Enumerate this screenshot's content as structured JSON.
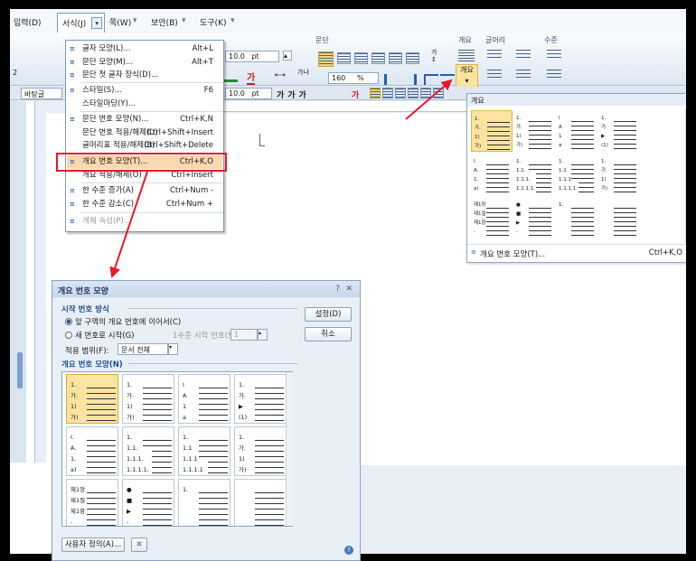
{
  "menubar": {
    "items": [
      {
        "label": "입력(D)"
      },
      {
        "label": "서식(J)"
      },
      {
        "label": "쪽(W)"
      },
      {
        "label": "보안(B)"
      },
      {
        "label": "도구(K)"
      }
    ]
  },
  "ribbon": {
    "paragraph_group": "문단",
    "outline_group": "개요",
    "bullet_group": "글머리",
    "level_group": "수준",
    "outline_button": "개요",
    "font_size": "10.0",
    "font_unit": "pt",
    "font_size2": "10.0",
    "line_spacing": "160",
    "line_unit": "%",
    "style_box": "바탕글",
    "left_fragment": "2"
  },
  "format_menu": {
    "items": [
      {
        "label": "글자 모양(L)...",
        "shortcut": "Alt+L",
        "icon": "char-shape-icon"
      },
      {
        "label": "문단 모양(M)...",
        "shortcut": "Alt+T",
        "icon": "para-shape-icon"
      },
      {
        "label": "문단 첫 글자 장식(D)...",
        "shortcut": "",
        "icon": "dropcap-icon"
      },
      {
        "label": "스타일(S)...",
        "shortcut": "F6",
        "icon": "style-icon"
      },
      {
        "label": "스타일마당(Y)...",
        "shortcut": "",
        "icon": ""
      },
      {
        "label": "문단 번호 모양(N)...",
        "shortcut": "Ctrl+K,N",
        "icon": "para-number-icon"
      },
      {
        "label": "문단 번호 적용/해제(U)",
        "shortcut": "Ctrl+Shift+Insert",
        "icon": ""
      },
      {
        "label": "글머리표 적용/해제(B)",
        "shortcut": "Ctrl+Shift+Delete",
        "icon": ""
      },
      {
        "label": "개요 번호 모양(T)...",
        "shortcut": "Ctrl+K,O",
        "icon": "outline-number-icon"
      },
      {
        "label": "개요 적용/해제(O)",
        "shortcut": "Ctrl+Insert",
        "icon": ""
      },
      {
        "label": "한 수준 증가(A)",
        "shortcut": "Ctrl+Num -",
        "icon": "level-up-icon"
      },
      {
        "label": "한 수준 감소(C)",
        "shortcut": "Ctrl+Num +",
        "icon": "level-down-icon"
      },
      {
        "label": "개체 속성(P)...",
        "shortcut": "",
        "icon": "object-icon"
      }
    ]
  },
  "outline_popup": {
    "header": "개요",
    "footer_label": "개요 번호 모양(T)...",
    "footer_shortcut": "Ctrl+K,O"
  },
  "dialog": {
    "title": "개요 번호 모양",
    "start_section": "시작 번호 방식",
    "radio_continue": "앞 구역의 개요 번호에 이어서(C)",
    "radio_new": "새 번호로 시작(G)",
    "level1_label": "1수준 시작 번호(S):",
    "level1_value": "1",
    "scope_label": "적용 범위(F):",
    "scope_value": "문서 전체",
    "shapes_section": "개요 번호 모양(N)",
    "set_button": "설정(D)",
    "cancel_button": "취소",
    "custom_button": "사용자 정의(A)...",
    "help_icon": "?",
    "close_icon": "✕"
  },
  "outline_patterns": [
    [
      "1.",
      "가.",
      "1)",
      "가)"
    ],
    [
      "1.",
      "가.",
      "1)",
      "가)"
    ],
    [
      "I",
      "A",
      "1",
      "a"
    ],
    [
      "1.",
      "가.",
      "▶",
      "(1)"
    ],
    [
      "I.",
      "A.",
      "1.",
      "a)"
    ],
    [
      "1.",
      "1.1.",
      "1.1.1.",
      "1.1.1.1."
    ],
    [
      "1.",
      "1.1",
      "1.1.1",
      "1.1.1.1"
    ],
    [
      "1.",
      "가.",
      "1)",
      "가)"
    ],
    [
      "제1장",
      "제1절",
      "제1항",
      "-"
    ],
    [
      "●",
      "■",
      "▶",
      "-"
    ],
    [
      "1.",
      "",
      "",
      ""
    ],
    [
      "",
      "",
      "",
      ""
    ]
  ],
  "colors": {
    "highlight_red": "#e8182a",
    "selected_fill": "#fbe3a0"
  }
}
